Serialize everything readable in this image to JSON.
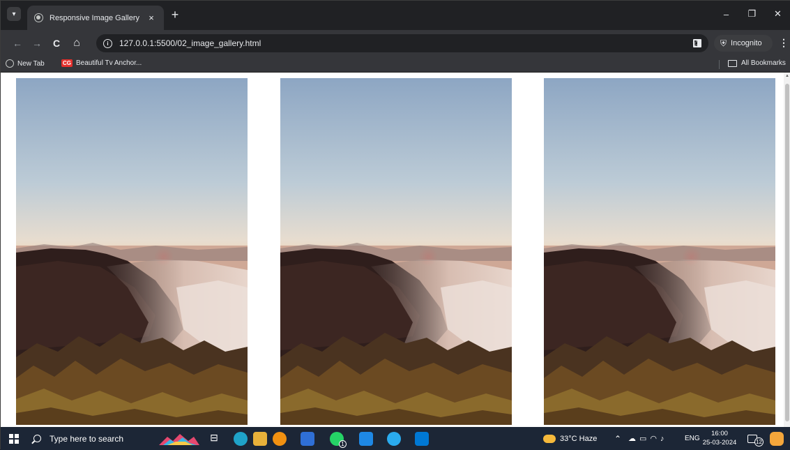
{
  "browser": {
    "tab": {
      "title": "Responsive Image Gallery",
      "close_glyph": "×"
    },
    "new_tab_glyph": "+",
    "window_controls": {
      "minimize": "–",
      "restore": "❐",
      "close": "✕"
    },
    "toolbar": {
      "back_glyph": "←",
      "forward_glyph": "→",
      "reload_glyph": "C",
      "home_glyph": "⌂",
      "url": "127.0.0.1:5500/02_image_gallery.html",
      "bookmark_star": "☆",
      "incognito_label": "Incognito",
      "menu_glyph": "⋮"
    },
    "bookmarks": {
      "items": [
        {
          "label": "New Tab",
          "icon": "globe-icon"
        },
        {
          "label": "Beautiful Tv Anchor...",
          "icon": "cg-logo",
          "logo_text": "CG"
        }
      ],
      "all_bookmarks": "All Bookmarks"
    }
  },
  "page": {
    "gallery": {
      "images": [
        {
          "name": "sunset-mountain-fog"
        },
        {
          "name": "sunset-mountain-fog"
        },
        {
          "name": "sunset-mountain-fog"
        }
      ]
    }
  },
  "taskbar": {
    "search_placeholder": "Type here to search",
    "weather": "33°C  Haze",
    "language": "ENG",
    "time": "16:00",
    "date": "25-03-2024",
    "whatsapp_badge": "1",
    "notification_count": "12",
    "colors": {
      "taskbar_bg": "#1c2636",
      "edge": "#1fa3c9",
      "explorer": "#e8b13a",
      "chrome": "#f29111",
      "store": "#2f6fd6",
      "whatsapp": "#25d366",
      "mail": "#1e88e5",
      "telegram": "#2aabee",
      "vscode": "#0078d4"
    }
  }
}
